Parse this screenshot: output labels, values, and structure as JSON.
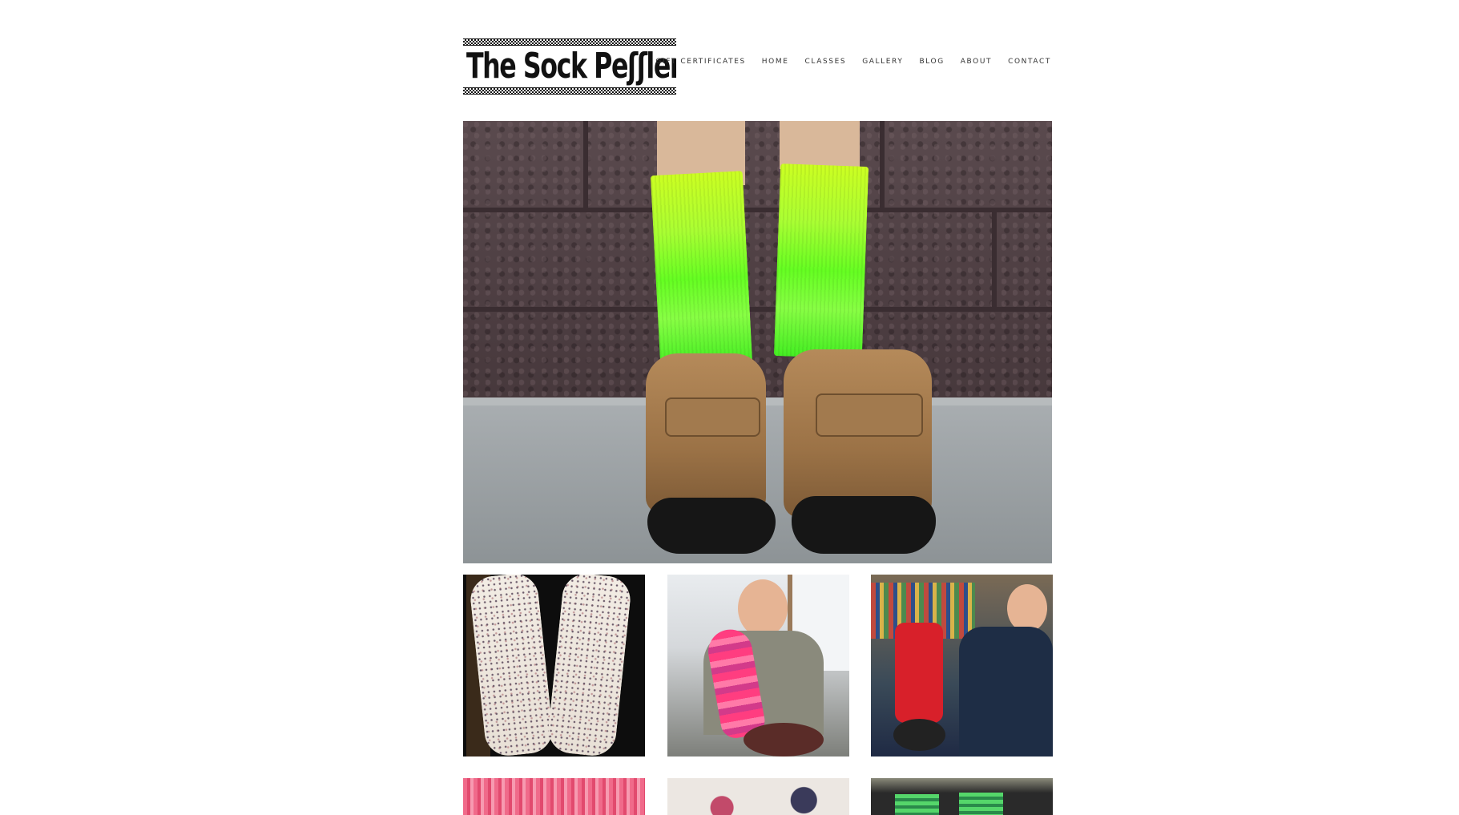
{
  "site": {
    "logo_text": "The Sock Peʃʃlers",
    "logo_alt": "The Sock Peddlers"
  },
  "nav": {
    "items": [
      {
        "label": "GIFT CERTIFICATES"
      },
      {
        "label": "HOME"
      },
      {
        "label": "CLASSES"
      },
      {
        "label": "GALLERY"
      },
      {
        "label": "BLOG"
      },
      {
        "label": "ABOUT"
      },
      {
        "label": "CONTACT"
      }
    ]
  },
  "hero": {
    "subject": "neon green knitted socks with tan boots"
  },
  "gallery": {
    "thumbnails": [
      {
        "subject": "speckled cream knitted socks"
      },
      {
        "subject": "man holding pink striped sock on knitting machine"
      },
      {
        "subject": "man with red sock on knitting machine"
      },
      {
        "subject": "pink knitted socks"
      },
      {
        "subject": "yarn pile"
      },
      {
        "subject": "green striped socks"
      }
    ]
  },
  "colors": {
    "background": "#ffffff",
    "nav_text": "#333333",
    "neon_green": "#aaff33"
  }
}
